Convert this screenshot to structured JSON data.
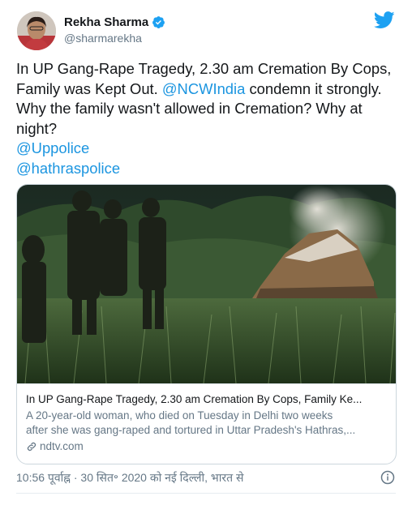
{
  "author": {
    "display_name": "Rekha Sharma",
    "handle": "@sharmarekha",
    "verified": true
  },
  "brand_icon": "twitter-bird-icon",
  "tweet": {
    "line1": "In UP Gang-Rape Tragedy, 2.30 am Cremation By Cops,",
    "line2_before": "Family was Kept Out. ",
    "line2_mention": "@NCWIndia",
    "line2_after": " condemn it strongly.",
    "line3": "Why the family wasn't allowed in Cremation?  Why at",
    "line4": "night?",
    "mention1": "@Uppolice",
    "mention2": "@hathraspolice"
  },
  "card": {
    "title": "In UP Gang-Rape Tragedy, 2.30 am Cremation By Cops, Family Ke...",
    "desc_line1": "A 20-year-old woman, who died on Tuesday in Delhi two weeks",
    "desc_line2": "after she was gang-raped and tortured in Uttar Pradesh's Hathras,...",
    "link": "ndtv.com"
  },
  "meta": {
    "timestamp": "10:56 पूर्वाह्न · 30 सित॰ 2020 को नई दिल्ली, भारत से"
  },
  "colors": {
    "link": "#1b95e0",
    "text": "#14171a",
    "muted": "#657786",
    "border": "#ccd6dd"
  }
}
